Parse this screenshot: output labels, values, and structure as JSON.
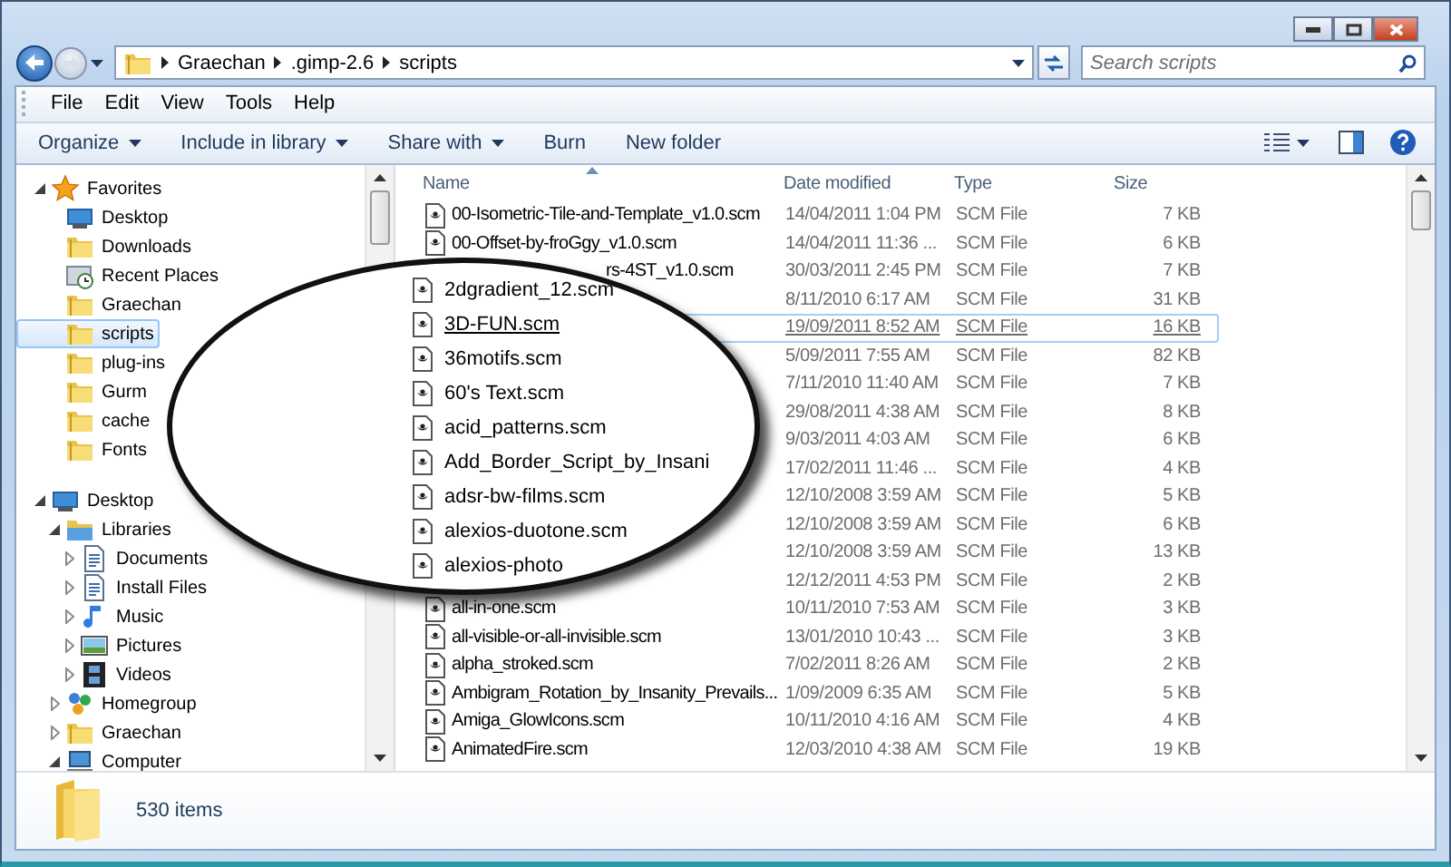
{
  "address": {
    "breadcrumbs": [
      "Graechan",
      ".gimp-2.6",
      "scripts"
    ]
  },
  "search": {
    "placeholder": "Search scripts"
  },
  "menu": [
    "File",
    "Edit",
    "View",
    "Tools",
    "Help"
  ],
  "toolbar": [
    {
      "label": "Organize",
      "dropdown": true
    },
    {
      "label": "Include in library",
      "dropdown": true
    },
    {
      "label": "Share with",
      "dropdown": true
    },
    {
      "label": "Burn",
      "dropdown": false
    },
    {
      "label": "New folder",
      "dropdown": false
    }
  ],
  "nav": [
    {
      "label": "Favorites",
      "kind": "favorites",
      "expanded": true,
      "selected": false,
      "children": [
        {
          "label": "Desktop",
          "kind": "desktop",
          "selected": false
        },
        {
          "label": "Downloads",
          "kind": "folder",
          "selected": false
        },
        {
          "label": "Recent Places",
          "kind": "recent",
          "selected": false
        },
        {
          "label": "Graechan",
          "kind": "folder",
          "selected": false
        },
        {
          "label": "scripts",
          "kind": "folder",
          "selected": true
        },
        {
          "label": "plug-ins",
          "kind": "folder",
          "selected": false
        },
        {
          "label": "Gurm",
          "kind": "folder",
          "selected": false
        },
        {
          "label": "cache",
          "kind": "folder",
          "selected": false
        },
        {
          "label": "Fonts",
          "kind": "folder",
          "selected": false
        }
      ]
    },
    {
      "label": "Desktop",
      "kind": "desktop",
      "expanded": true,
      "selected": false,
      "children": [
        {
          "label": "Libraries",
          "kind": "library",
          "expanded": true,
          "selected": false,
          "children": [
            {
              "label": "Documents",
              "kind": "document",
              "expanded": false,
              "selected": false
            },
            {
              "label": "Install Files",
              "kind": "document",
              "expanded": false,
              "selected": false
            },
            {
              "label": "Music",
              "kind": "music",
              "expanded": false,
              "selected": false
            },
            {
              "label": "Pictures",
              "kind": "picture",
              "expanded": false,
              "selected": false
            },
            {
              "label": "Videos",
              "kind": "video",
              "expanded": false,
              "selected": false
            }
          ]
        },
        {
          "label": "Homegroup",
          "kind": "homegroup",
          "expanded": false,
          "selected": false
        },
        {
          "label": "Graechan",
          "kind": "folder",
          "expanded": false,
          "selected": false
        },
        {
          "label": "Computer",
          "kind": "computer",
          "expanded": true,
          "selected": false
        }
      ]
    }
  ],
  "files": {
    "columns": [
      "Name",
      "Date modified",
      "Type",
      "Size"
    ],
    "rows": [
      {
        "kind": "file",
        "name": "00-Isometric-Tile-and-Template_v1.0.scm",
        "date": "14/04/2011 1:04 PM",
        "type": "SCM File",
        "size": "7 KB",
        "hot": false
      },
      {
        "kind": "file",
        "name": "00-Offset-by-froGgy_v1.0.scm",
        "date": "14/04/2011 11:36 ...",
        "type": "SCM File",
        "size": "6 KB",
        "hot": false
      },
      {
        "kind": "under-lens",
        "name": "rs-4ST_v1.0.scm",
        "date": "30/03/2011 2:45 PM",
        "type": "SCM File",
        "size": "7 KB",
        "hot": false
      },
      {
        "kind": "under-lens",
        "date": "8/11/2010 6:17 AM",
        "type": "SCM File",
        "size": "31 KB",
        "hot": false
      },
      {
        "kind": "under-lens",
        "date": "19/09/2011 8:52 AM",
        "type": "SCM File",
        "size": "16 KB",
        "hot": true
      },
      {
        "kind": "under-lens",
        "date": "5/09/2011 7:55 AM",
        "type": "SCM File",
        "size": "82 KB",
        "hot": false
      },
      {
        "kind": "under-lens",
        "date": "7/11/2010 11:40 AM",
        "type": "SCM File",
        "size": "7 KB",
        "hot": false
      },
      {
        "kind": "under-lens",
        "date": "29/08/2011 4:38 AM",
        "type": "SCM File",
        "size": "8 KB",
        "hot": false
      },
      {
        "kind": "under-lens",
        "date": "9/03/2011 4:03 AM",
        "type": "SCM File",
        "size": "6 KB",
        "hot": false
      },
      {
        "kind": "under-lens",
        "date": "17/02/2011 11:46 ...",
        "type": "SCM File",
        "size": "4 KB",
        "hot": false
      },
      {
        "kind": "under-lens",
        "date": "12/10/2008 3:59 AM",
        "type": "SCM File",
        "size": "5 KB",
        "hot": false
      },
      {
        "kind": "under-lens",
        "date": "12/10/2008 3:59 AM",
        "type": "SCM File",
        "size": "6 KB",
        "hot": false
      },
      {
        "kind": "under-lens",
        "date": "12/10/2008 3:59 AM",
        "type": "SCM File",
        "size": "13 KB",
        "hot": false
      },
      {
        "kind": "under-lens",
        "date": "12/12/2011 4:53 PM",
        "type": "SCM File",
        "size": "2 KB",
        "hot": false
      },
      {
        "kind": "file",
        "name": "all-in-one.scm",
        "date": "10/11/2010 7:53 AM",
        "type": "SCM File",
        "size": "3 KB",
        "hot": false
      },
      {
        "kind": "file",
        "name": "all-visible-or-all-invisible.scm",
        "date": "13/01/2010 10:43 ...",
        "type": "SCM File",
        "size": "3 KB",
        "hot": false
      },
      {
        "kind": "file",
        "name": "alpha_stroked.scm",
        "date": "7/02/2011 8:26 AM",
        "type": "SCM File",
        "size": "2 KB",
        "hot": false
      },
      {
        "kind": "file",
        "name": "Ambigram_Rotation_by_Insanity_Prevails...",
        "date": "1/09/2009 6:35 AM",
        "type": "SCM File",
        "size": "5 KB",
        "hot": false
      },
      {
        "kind": "file",
        "name": "Amiga_GlowIcons.scm",
        "date": "10/11/2010 4:16 AM",
        "type": "SCM File",
        "size": "4 KB",
        "hot": false
      },
      {
        "kind": "file",
        "name": "AnimatedFire.scm",
        "date": "12/03/2010 4:38 AM",
        "type": "SCM File",
        "size": "19 KB",
        "hot": false
      }
    ],
    "lens": [
      {
        "name": "2dgradient_12.scm",
        "hot": false
      },
      {
        "name": "3D-FUN.scm",
        "hot": true
      },
      {
        "name": "36motifs.scm",
        "hot": false
      },
      {
        "name": "60's Text.scm",
        "hot": false
      },
      {
        "name": "acid_patterns.scm",
        "hot": false
      },
      {
        "name": "Add_Border_Script_by_Insani",
        "hot": false
      },
      {
        "name": "adsr-bw-films.scm",
        "hot": false
      },
      {
        "name": "alexios-duotone.scm",
        "hot": false
      },
      {
        "name": "alexios-photo",
        "hot": false
      }
    ]
  },
  "status": {
    "count": "530 items"
  }
}
